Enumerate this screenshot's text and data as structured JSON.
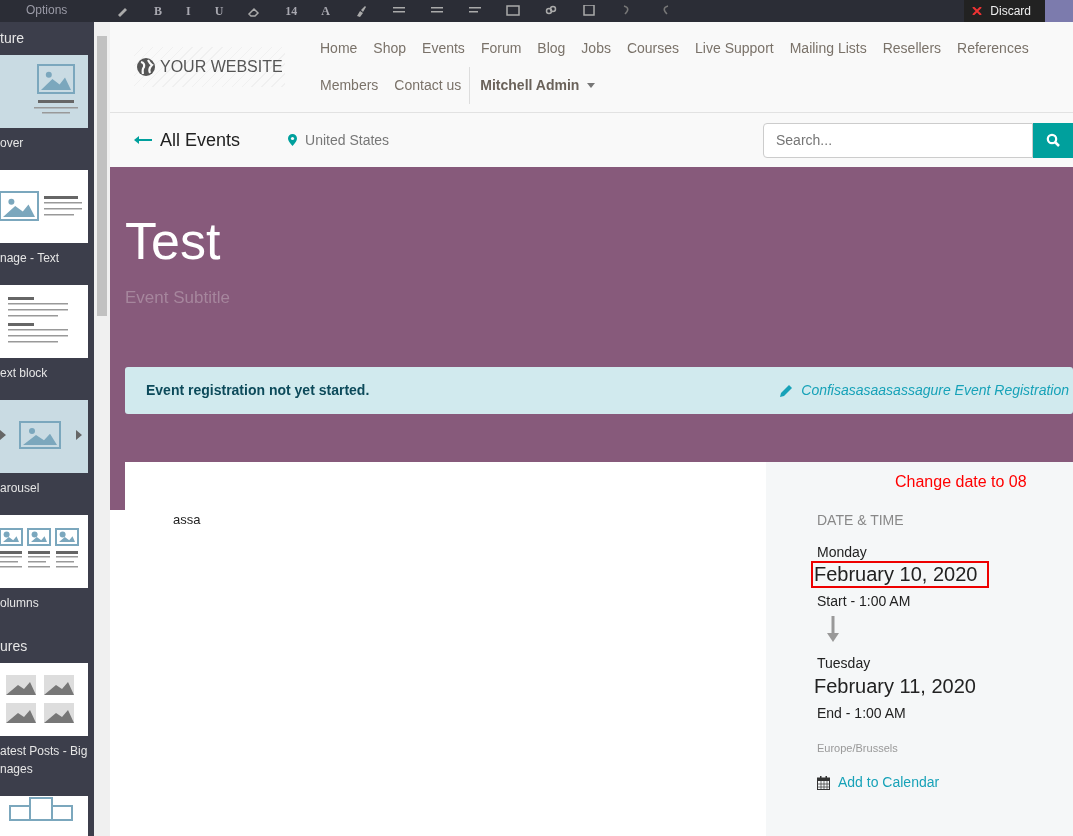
{
  "toolbar": {
    "options_label": "Options",
    "font_size": "14",
    "discard": "Discard",
    "items": [
      {
        "kind": "icon"
      },
      {
        "kind": "text",
        "text": "B"
      },
      {
        "kind": "text",
        "text": "I"
      },
      {
        "kind": "text",
        "text": "U"
      },
      {
        "kind": "icon"
      },
      {
        "kind": "size"
      },
      {
        "kind": "text",
        "text": "A"
      },
      {
        "kind": "icon"
      },
      {
        "kind": "icon"
      },
      {
        "kind": "icon"
      },
      {
        "kind": "icon"
      },
      {
        "kind": "icon"
      },
      {
        "kind": "icon"
      },
      {
        "kind": "icon"
      },
      {
        "kind": "icon"
      },
      {
        "kind": "icon"
      }
    ]
  },
  "sidebar": {
    "sections": [
      {
        "title": "ture",
        "snippets": [
          {
            "kind": "cover",
            "label": "over"
          },
          {
            "kind": "image-text",
            "label": "nage - Text"
          },
          {
            "kind": "text-block",
            "label": "ext block"
          },
          {
            "kind": "carousel",
            "label": "arousel"
          },
          {
            "kind": "columns",
            "label": "olumns"
          }
        ]
      },
      {
        "title": "ures",
        "snippets": [
          {
            "kind": "posts",
            "label": "atest Posts - Big nages"
          },
          {
            "kind": "tabs"
          }
        ]
      }
    ]
  },
  "navbar": {
    "logo": "YOUR WEBSITE",
    "links": [
      "Home",
      "Shop",
      "Events",
      "Forum",
      "Blog",
      "Jobs",
      "Courses",
      "Live Support",
      "Mailing Lists",
      "Resellers",
      "References",
      "Members",
      "Contact us"
    ],
    "user": "Mitchell Admin"
  },
  "subheader": {
    "back": "All Events",
    "location": "United States",
    "search": {
      "placeholder": "Search..."
    }
  },
  "banner": {
    "title": "Test",
    "subtitle": "Event Subtitle"
  },
  "alert": {
    "message": "Event registration not yet started.",
    "action": "Confisasasaasassagure Event Registration"
  },
  "content": {
    "body": "assa"
  },
  "date_panel": {
    "annotation": "Change date to 08",
    "heading": "DATE & TIME",
    "start": {
      "weekday": "Monday",
      "date": "February 10, 2020",
      "time": "Start - 1:00 AM",
      "highlighted": true
    },
    "end": {
      "weekday": "Tuesday",
      "date": "February 11, 2020",
      "time": "End - 1:00 AM",
      "highlighted": false
    },
    "timezone": "Europe/Brussels",
    "calendar_link": "Add to Calendar"
  }
}
